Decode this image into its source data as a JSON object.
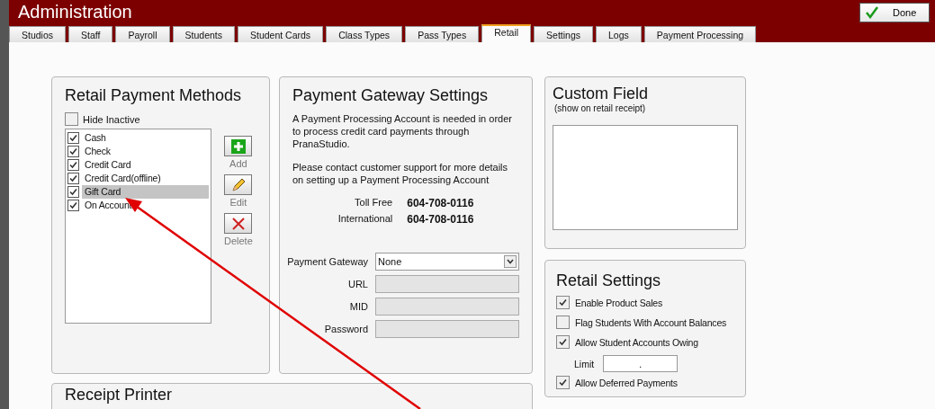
{
  "window": {
    "title": "Administration",
    "done_button": "Done"
  },
  "tabs": [
    {
      "label": "Studios",
      "selected": false
    },
    {
      "label": "Staff",
      "selected": false
    },
    {
      "label": "Payroll",
      "selected": false
    },
    {
      "label": "Students",
      "selected": false
    },
    {
      "label": "Student Cards",
      "selected": false
    },
    {
      "label": "Class Types",
      "selected": false
    },
    {
      "label": "Pass Types",
      "selected": false
    },
    {
      "label": "Retail",
      "selected": true
    },
    {
      "label": "Settings",
      "selected": false
    },
    {
      "label": "Logs",
      "selected": false
    },
    {
      "label": "Payment Processing",
      "selected": false
    }
  ],
  "payment_methods": {
    "title": "Retail Payment Methods",
    "hide_inactive": {
      "label": "Hide Inactive",
      "checked": false
    },
    "items": [
      {
        "label": "Cash",
        "checked": true,
        "selected": false
      },
      {
        "label": "Check",
        "checked": true,
        "selected": false
      },
      {
        "label": "Credit Card",
        "checked": true,
        "selected": false
      },
      {
        "label": "Credit Card(offline)",
        "checked": true,
        "selected": false
      },
      {
        "label": "Gift Card",
        "checked": true,
        "selected": true
      },
      {
        "label": "On Account",
        "checked": true,
        "selected": false
      }
    ],
    "actions": [
      {
        "kind": "add",
        "label": "Add"
      },
      {
        "kind": "edit",
        "label": "Edit"
      },
      {
        "kind": "delete",
        "label": "Delete"
      }
    ]
  },
  "gateway": {
    "title": "Payment Gateway Settings",
    "paragraphs": [
      "A Payment Processing Account is needed in order to process credit card payments through PranaStudio.",
      "Please contact customer support for more details on setting up a Payment Processing Account"
    ],
    "phones": [
      {
        "label": "Toll Free",
        "number": "604-708-0116"
      },
      {
        "label": "International",
        "number": "604-708-0116"
      }
    ],
    "fields": [
      {
        "kind": "select",
        "label": "Payment Gateway",
        "value": "None"
      },
      {
        "kind": "text",
        "label": "URL"
      },
      {
        "kind": "text",
        "label": "MID"
      },
      {
        "kind": "text",
        "label": "Password"
      }
    ]
  },
  "custom_field": {
    "title": "Custom Field",
    "subtitle": "(show on retail receipt)"
  },
  "retail_settings": {
    "title": "Retail Settings",
    "options": [
      {
        "kind": "check",
        "label": "Enable Product Sales",
        "checked": true
      },
      {
        "kind": "check",
        "label": "Flag Students With Account Balances",
        "checked": false
      },
      {
        "kind": "check",
        "label": "Allow Student Accounts Owing",
        "checked": true,
        "limit": {
          "label": "Limit",
          "value": "."
        }
      },
      {
        "kind": "check",
        "label": "Allow Deferred Payments",
        "checked": true
      }
    ]
  },
  "receipt_printer": {
    "title": "Receipt Printer"
  }
}
